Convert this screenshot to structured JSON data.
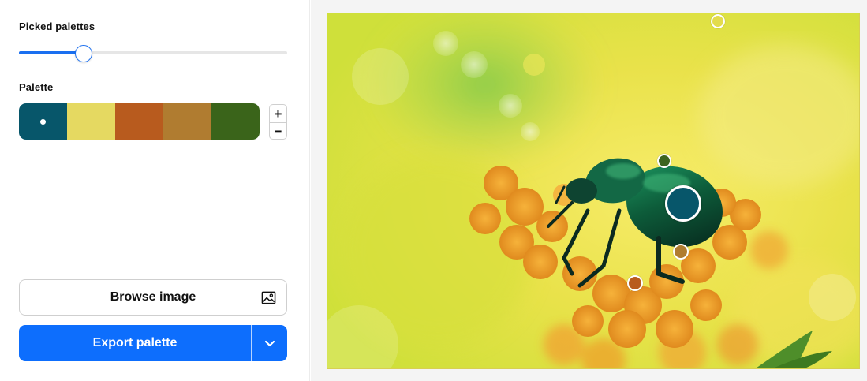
{
  "sidebar": {
    "picked_title": "Picked palettes",
    "slider_value": 0.24,
    "palette_title": "Palette",
    "palette": [
      {
        "color": "#07566a",
        "selected": true
      },
      {
        "color": "#e5d961",
        "selected": false
      },
      {
        "color": "#b85b1e",
        "selected": false
      },
      {
        "color": "#b07c30",
        "selected": false
      },
      {
        "color": "#3a641a",
        "selected": false
      }
    ],
    "stepper": {
      "plus": "+",
      "minus": "−"
    },
    "browse_label": "Browse image",
    "browse_icon": "image-icon",
    "export_label": "Export palette",
    "export_dropdown_icon": "chevron-down-icon",
    "accent_color": "#0d6efd"
  },
  "image": {
    "pickers": [
      {
        "color": "#e3dc4d",
        "selected": false
      },
      {
        "color": "#3d6420",
        "selected": false
      },
      {
        "color": "#07566a",
        "selected": true
      },
      {
        "color": "#b07c30",
        "selected": false
      },
      {
        "color": "#b85b1e",
        "selected": false
      }
    ]
  }
}
